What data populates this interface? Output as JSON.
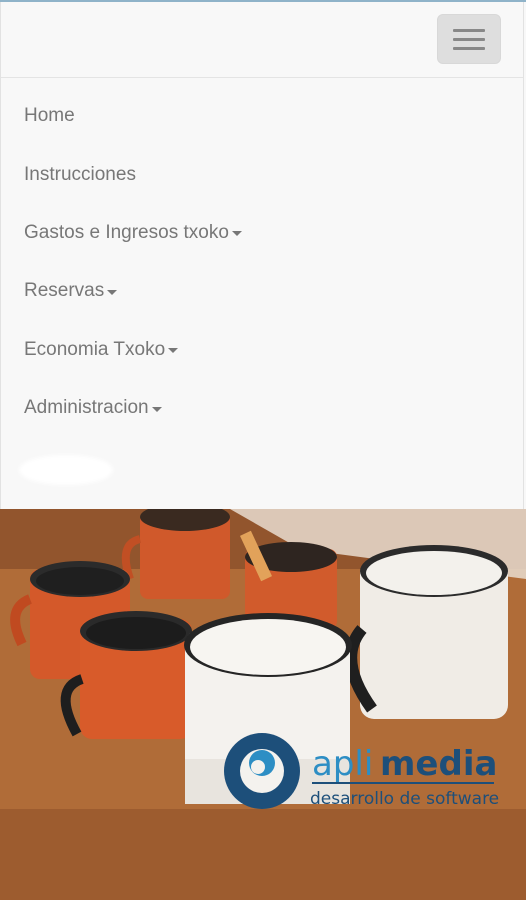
{
  "navbar": {
    "toggle_label": "Toggle navigation",
    "items": [
      {
        "label": "Home",
        "dropdown": false
      },
      {
        "label": "Instrucciones",
        "dropdown": false
      },
      {
        "label": "Gastos e Ingresos txoko",
        "dropdown": true
      },
      {
        "label": "Reservas",
        "dropdown": true
      },
      {
        "label": "Economia Txoko",
        "dropdown": true
      },
      {
        "label": "Administracion",
        "dropdown": true
      }
    ]
  },
  "hero": {
    "logo": {
      "name_part1": "apli",
      "name_part2": "media",
      "tagline": "desarrollo de software"
    }
  },
  "colors": {
    "navbar_bg": "#f8f8f8",
    "menu_text": "#777777",
    "logo_blue": "#1d4f7a",
    "logo_light_blue": "#2d8ec4"
  }
}
